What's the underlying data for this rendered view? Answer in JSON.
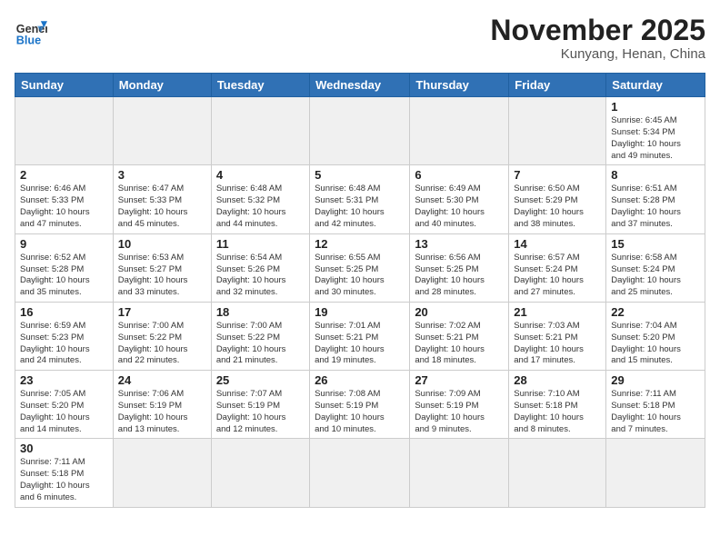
{
  "header": {
    "logo_general": "General",
    "logo_blue": "Blue",
    "month": "November 2025",
    "location": "Kunyang, Henan, China"
  },
  "weekdays": [
    "Sunday",
    "Monday",
    "Tuesday",
    "Wednesday",
    "Thursday",
    "Friday",
    "Saturday"
  ],
  "weeks": [
    [
      {
        "day": "",
        "text": ""
      },
      {
        "day": "",
        "text": ""
      },
      {
        "day": "",
        "text": ""
      },
      {
        "day": "",
        "text": ""
      },
      {
        "day": "",
        "text": ""
      },
      {
        "day": "",
        "text": ""
      },
      {
        "day": "1",
        "text": "Sunrise: 6:45 AM\nSunset: 5:34 PM\nDaylight: 10 hours\nand 49 minutes."
      }
    ],
    [
      {
        "day": "2",
        "text": "Sunrise: 6:46 AM\nSunset: 5:33 PM\nDaylight: 10 hours\nand 47 minutes."
      },
      {
        "day": "3",
        "text": "Sunrise: 6:47 AM\nSunset: 5:33 PM\nDaylight: 10 hours\nand 45 minutes."
      },
      {
        "day": "4",
        "text": "Sunrise: 6:48 AM\nSunset: 5:32 PM\nDaylight: 10 hours\nand 44 minutes."
      },
      {
        "day": "5",
        "text": "Sunrise: 6:48 AM\nSunset: 5:31 PM\nDaylight: 10 hours\nand 42 minutes."
      },
      {
        "day": "6",
        "text": "Sunrise: 6:49 AM\nSunset: 5:30 PM\nDaylight: 10 hours\nand 40 minutes."
      },
      {
        "day": "7",
        "text": "Sunrise: 6:50 AM\nSunset: 5:29 PM\nDaylight: 10 hours\nand 38 minutes."
      },
      {
        "day": "8",
        "text": "Sunrise: 6:51 AM\nSunset: 5:28 PM\nDaylight: 10 hours\nand 37 minutes."
      }
    ],
    [
      {
        "day": "9",
        "text": "Sunrise: 6:52 AM\nSunset: 5:28 PM\nDaylight: 10 hours\nand 35 minutes."
      },
      {
        "day": "10",
        "text": "Sunrise: 6:53 AM\nSunset: 5:27 PM\nDaylight: 10 hours\nand 33 minutes."
      },
      {
        "day": "11",
        "text": "Sunrise: 6:54 AM\nSunset: 5:26 PM\nDaylight: 10 hours\nand 32 minutes."
      },
      {
        "day": "12",
        "text": "Sunrise: 6:55 AM\nSunset: 5:25 PM\nDaylight: 10 hours\nand 30 minutes."
      },
      {
        "day": "13",
        "text": "Sunrise: 6:56 AM\nSunset: 5:25 PM\nDaylight: 10 hours\nand 28 minutes."
      },
      {
        "day": "14",
        "text": "Sunrise: 6:57 AM\nSunset: 5:24 PM\nDaylight: 10 hours\nand 27 minutes."
      },
      {
        "day": "15",
        "text": "Sunrise: 6:58 AM\nSunset: 5:24 PM\nDaylight: 10 hours\nand 25 minutes."
      }
    ],
    [
      {
        "day": "16",
        "text": "Sunrise: 6:59 AM\nSunset: 5:23 PM\nDaylight: 10 hours\nand 24 minutes."
      },
      {
        "day": "17",
        "text": "Sunrise: 7:00 AM\nSunset: 5:22 PM\nDaylight: 10 hours\nand 22 minutes."
      },
      {
        "day": "18",
        "text": "Sunrise: 7:00 AM\nSunset: 5:22 PM\nDaylight: 10 hours\nand 21 minutes."
      },
      {
        "day": "19",
        "text": "Sunrise: 7:01 AM\nSunset: 5:21 PM\nDaylight: 10 hours\nand 19 minutes."
      },
      {
        "day": "20",
        "text": "Sunrise: 7:02 AM\nSunset: 5:21 PM\nDaylight: 10 hours\nand 18 minutes."
      },
      {
        "day": "21",
        "text": "Sunrise: 7:03 AM\nSunset: 5:21 PM\nDaylight: 10 hours\nand 17 minutes."
      },
      {
        "day": "22",
        "text": "Sunrise: 7:04 AM\nSunset: 5:20 PM\nDaylight: 10 hours\nand 15 minutes."
      }
    ],
    [
      {
        "day": "23",
        "text": "Sunrise: 7:05 AM\nSunset: 5:20 PM\nDaylight: 10 hours\nand 14 minutes."
      },
      {
        "day": "24",
        "text": "Sunrise: 7:06 AM\nSunset: 5:19 PM\nDaylight: 10 hours\nand 13 minutes."
      },
      {
        "day": "25",
        "text": "Sunrise: 7:07 AM\nSunset: 5:19 PM\nDaylight: 10 hours\nand 12 minutes."
      },
      {
        "day": "26",
        "text": "Sunrise: 7:08 AM\nSunset: 5:19 PM\nDaylight: 10 hours\nand 10 minutes."
      },
      {
        "day": "27",
        "text": "Sunrise: 7:09 AM\nSunset: 5:19 PM\nDaylight: 10 hours\nand 9 minutes."
      },
      {
        "day": "28",
        "text": "Sunrise: 7:10 AM\nSunset: 5:18 PM\nDaylight: 10 hours\nand 8 minutes."
      },
      {
        "day": "29",
        "text": "Sunrise: 7:11 AM\nSunset: 5:18 PM\nDaylight: 10 hours\nand 7 minutes."
      }
    ],
    [
      {
        "day": "30",
        "text": "Sunrise: 7:11 AM\nSunset: 5:18 PM\nDaylight: 10 hours\nand 6 minutes."
      },
      {
        "day": "",
        "text": ""
      },
      {
        "day": "",
        "text": ""
      },
      {
        "day": "",
        "text": ""
      },
      {
        "day": "",
        "text": ""
      },
      {
        "day": "",
        "text": ""
      },
      {
        "day": "",
        "text": ""
      }
    ]
  ]
}
